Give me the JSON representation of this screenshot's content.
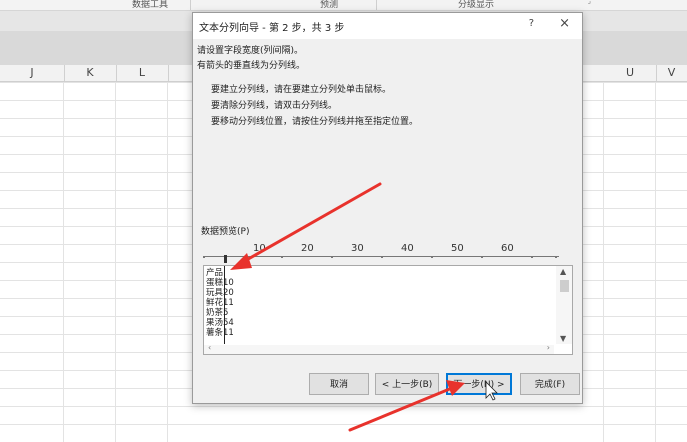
{
  "ribbon": {
    "group1": "数据工具",
    "group2": "预测",
    "group3": "分级显示"
  },
  "columns": [
    "J",
    "K",
    "L",
    "U",
    "V"
  ],
  "dialog": {
    "title": "文本分列向导 - 第 2 步，共 3 步",
    "help": "?",
    "close": "×",
    "intro_line1": "请设置字段宽度(列间隔)。",
    "intro_line2": "有箭头的垂直线为分列线。",
    "instructions": [
      "要建立分列线，请在要建立分列处单击鼠标。",
      "要清除分列线，请双击分列线。",
      "要移动分列线位置，请按住分列线并拖至指定位置。"
    ],
    "preview_label": "数据预览(P)",
    "ruler_ticks": [
      "10",
      "20",
      "30",
      "40",
      "50",
      "60"
    ],
    "preview_rows": [
      "产品",
      "蛋糕10",
      "玩具20",
      "鲜花11",
      "奶茶5",
      "果汤54",
      "薯条11"
    ],
    "buttons": {
      "cancel": "取消",
      "back": "< 上一步(B)",
      "next": "下一步(N) >",
      "finish": "完成(F)"
    }
  },
  "colors": {
    "annotation_arrow": "#e8322c",
    "focus_border": "#0078d7"
  }
}
